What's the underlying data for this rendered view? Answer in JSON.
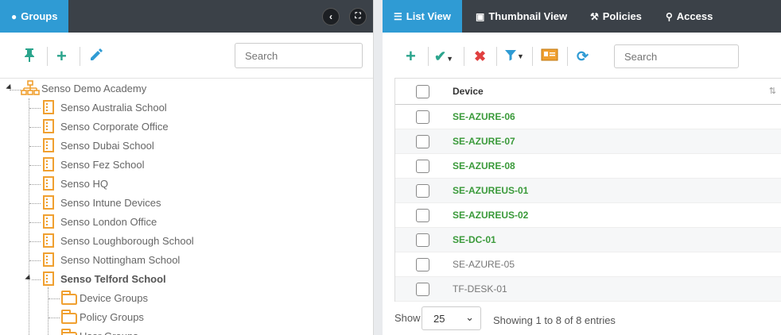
{
  "left_panel": {
    "tab_label": "Groups",
    "collapse_icon": "chevron-left-icon",
    "expand_icon": "fullscreen-icon",
    "search_placeholder": "Search",
    "tree": {
      "root": "Senso Demo Academy",
      "children": [
        "Senso Australia School",
        "Senso Corporate Office",
        "Senso Dubai School",
        "Senso Fez School",
        "Senso HQ",
        "Senso Intune Devices",
        "Senso London Office",
        "Senso Loughborough School",
        "Senso Nottingham School",
        "Senso Telford School"
      ],
      "telford_children": [
        "Device Groups",
        "Policy Groups",
        "User Groups"
      ]
    }
  },
  "right_panel": {
    "tabs": [
      {
        "label": "List View",
        "icon": "list-icon"
      },
      {
        "label": "Thumbnail View",
        "icon": "monitor-icon"
      },
      {
        "label": "Policies",
        "icon": "gavel-icon"
      },
      {
        "label": "Access",
        "icon": "key-icon"
      }
    ],
    "search_placeholder": "Search",
    "table": {
      "column": "Device",
      "rows": [
        {
          "name": "SE-AZURE-06",
          "status": "online"
        },
        {
          "name": "SE-AZURE-07",
          "status": "online"
        },
        {
          "name": "SE-AZURE-08",
          "status": "online"
        },
        {
          "name": "SE-AZUREUS-01",
          "status": "online"
        },
        {
          "name": "SE-AZUREUS-02",
          "status": "online"
        },
        {
          "name": "SE-DC-01",
          "status": "online"
        },
        {
          "name": "SE-AZURE-05",
          "status": "offline"
        },
        {
          "name": "TF-DESK-01",
          "status": "offline"
        }
      ]
    },
    "footer": {
      "show_label": "Show",
      "page_size": "25",
      "summary": "Showing 1 to 8 of 8 entries"
    }
  },
  "colors": {
    "accent": "#2f9bd4",
    "header_bar": "#3b4148",
    "online": "#3a9a3a",
    "add": "#2ca58d",
    "delete": "#e04040",
    "folder": "#f0a030"
  }
}
